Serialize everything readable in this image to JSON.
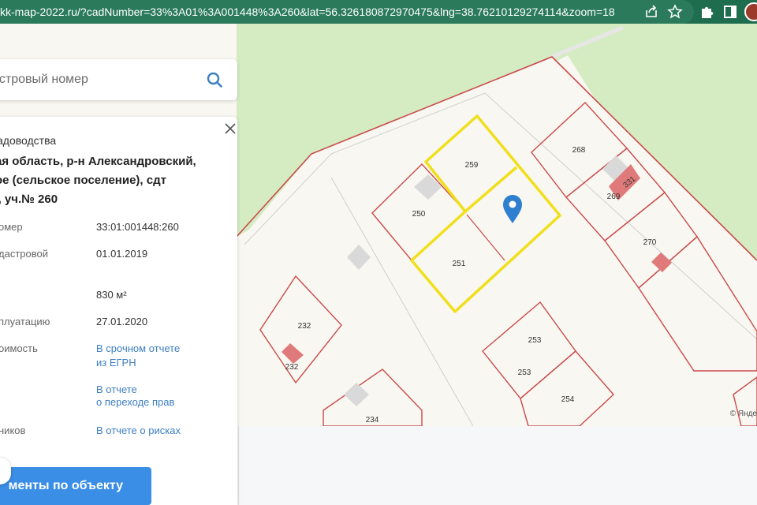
{
  "browser": {
    "url": "kk-map-2022.ru/?cadNumber=33%3A01%3A001448%3A260&lat=56.326180872970475&lng=38.76210129274114&zoom=18"
  },
  "search": {
    "placeholder": "астровый номер"
  },
  "info": {
    "category": "адоводства",
    "address_lines": [
      "ая область, р-н Александровский,",
      "ое (сельское поселение), сдт",
      "', уч.№ 260"
    ],
    "rows": {
      "cad_number_label": "омер",
      "cad_number_value": "33:01:001448:260",
      "cad_date_label": "дастровой",
      "cad_date_value": "01.01.2019",
      "area_value": "830 м²",
      "exploit_label": "плуатацию",
      "exploit_value": "27.01.2020",
      "cost_label": "оимость",
      "cost_link_1": "В срочном отчете",
      "cost_link_2": "из ЕГРН",
      "transfer_link_1": "В отчете",
      "transfer_link_2": "о переходе прав",
      "owners_label": "ников",
      "risk_link": "В отчете о рисках"
    },
    "docs_button": "менты по объекту"
  },
  "map": {
    "copyright": "© Янде",
    "parcel_labels": [
      "259",
      "250",
      "251",
      "268",
      "269",
      "331",
      "270",
      "232",
      "232",
      "253",
      "253",
      "254",
      "234"
    ],
    "colors": {
      "forest": "#d5ecc2",
      "background": "#f9f7f1",
      "parcel_border": "#c94a4a",
      "selected_border": "#f0df1a",
      "marker": "#2f7fd1",
      "building_red": "#e07a7a"
    }
  }
}
